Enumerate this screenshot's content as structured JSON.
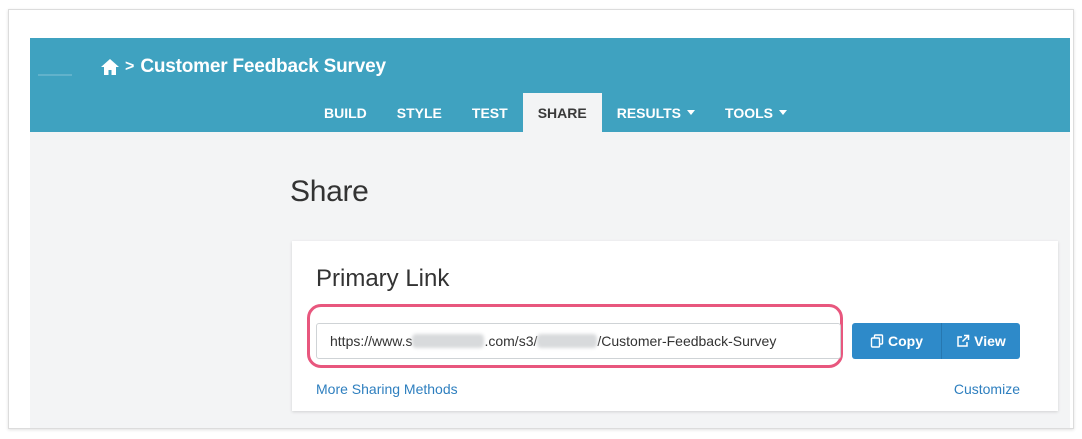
{
  "header": {
    "breadcrumb_separator": ">",
    "survey_title": "Customer Feedback Survey",
    "tabs": [
      {
        "label": "BUILD",
        "active": false,
        "dropdown": false
      },
      {
        "label": "STYLE",
        "active": false,
        "dropdown": false
      },
      {
        "label": "TEST",
        "active": false,
        "dropdown": false
      },
      {
        "label": "SHARE",
        "active": true,
        "dropdown": false
      },
      {
        "label": "RESULTS",
        "active": false,
        "dropdown": true
      },
      {
        "label": "TOOLS",
        "active": false,
        "dropdown": true
      }
    ],
    "icons": {
      "home": "home-icon",
      "dropdown": "caret-down-icon"
    }
  },
  "main": {
    "heading": "Share"
  },
  "primary_link": {
    "title": "Primary Link",
    "url_prefix": "https://www.s",
    "url_middle": ".com/s3/",
    "url_suffix": "/Customer-Feedback-Survey",
    "copy_label": "Copy",
    "view_label": "View",
    "more_sharing_label": "More Sharing Methods",
    "customize_label": "Customize",
    "icons": {
      "copy": "copy-icon",
      "view": "external-link-icon"
    }
  },
  "colors": {
    "header_bg": "#3fa2c0",
    "button_bg": "#2e8ac9",
    "link": "#2e7fbf",
    "highlight": "#e8577e"
  }
}
